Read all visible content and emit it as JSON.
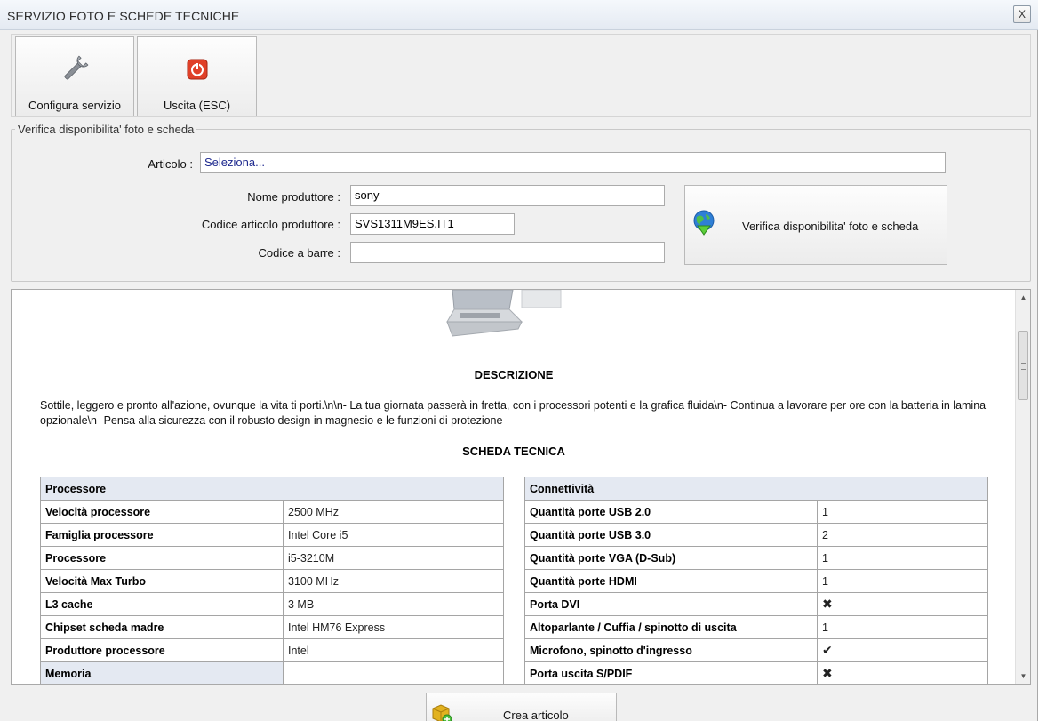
{
  "window": {
    "title": "SERVIZIO FOTO E SCHEDE TECNICHE",
    "close_label": "X"
  },
  "toolbar": {
    "configure_label": "Configura servizio",
    "exit_label": "Uscita (ESC)"
  },
  "verify_group": {
    "legend": "Verifica disponibilita' foto e scheda",
    "article_label": "Articolo :",
    "article_value": "Seleziona...",
    "manufacturer_label": "Nome produttore :",
    "manufacturer_value": "sony",
    "mfr_code_label": "Codice articolo produttore :",
    "mfr_code_value": "SVS1311M9ES.IT1",
    "barcode_label": "Codice a barre :",
    "barcode_value": "",
    "verify_button_label": "Verifica disponibilita' foto e scheda"
  },
  "content": {
    "description_title": "DESCRIZIONE",
    "description_text": "Sottile, leggero e pronto all'azione, ovunque la vita ti porti.\\n\\n- La tua giornata passerà in fretta, con i processori potenti e la grafica fluida\\n- Continua a lavorare per ore con la batteria in lamina opzionale\\n- Pensa alla sicurezza con il robusto design in magnesio e le funzioni di protezione",
    "spec_title": "SCHEDA TECNICA",
    "left_table": {
      "header": "Processore",
      "rows": [
        {
          "key": "Velocità processore",
          "value": "2500 MHz"
        },
        {
          "key": "Famiglia processore",
          "value": "Intel Core i5"
        },
        {
          "key": "Processore",
          "value": "i5-3210M"
        },
        {
          "key": "Velocità Max Turbo",
          "value": "3100 MHz"
        },
        {
          "key": "L3 cache",
          "value": "3 MB"
        },
        {
          "key": "Chipset scheda madre",
          "value": "Intel HM76 Express"
        },
        {
          "key": "Produttore processore",
          "value": "Intel"
        }
      ],
      "next_header": "Memoria"
    },
    "right_table": {
      "header": "Connettività",
      "rows": [
        {
          "key": "Quantità porte USB 2.0",
          "value": "1"
        },
        {
          "key": "Quantità porte USB 3.0",
          "value": "2"
        },
        {
          "key": "Quantità porte VGA (D-Sub)",
          "value": "1"
        },
        {
          "key": "Quantità porte HDMI",
          "value": "1"
        },
        {
          "key": "Porta DVI",
          "value": "✖",
          "mark": "cross"
        },
        {
          "key": "Altoparlante / Cuffia / spinotto di uscita",
          "value": "1"
        },
        {
          "key": "Microfono, spinotto d'ingresso",
          "value": "✔",
          "mark": "check"
        },
        {
          "key": "Porta uscita S/PDIF",
          "value": "✖",
          "mark": "cross"
        }
      ]
    }
  },
  "bottom": {
    "create_label": "Crea articolo"
  },
  "icons": {
    "configure": "wrench-icon",
    "exit": "power-icon",
    "verify": "globe-download-icon",
    "create": "box-add-icon"
  },
  "colors": {
    "table_header_bg": "#e4e9f2",
    "cross": "#e02020",
    "check": "#1f9a2f",
    "article_text": "#1f2a8f"
  }
}
